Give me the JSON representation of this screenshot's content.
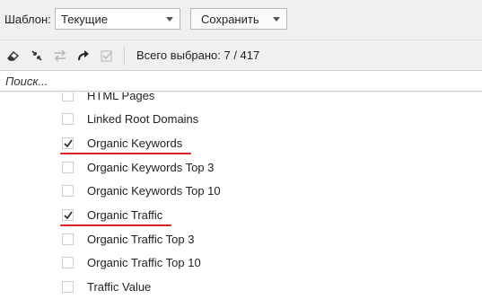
{
  "template": {
    "label": "Шаблон:",
    "selected": "Текущие",
    "save_label": "Сохранить"
  },
  "toolbar": {
    "icons": [
      "eraser-icon",
      "collapse-icon",
      "swap-icon",
      "redo-icon",
      "check-square-icon"
    ],
    "selection_count": "Всего выбрано: 7 / 417"
  },
  "search": {
    "placeholder": "Поиск..."
  },
  "columns": [
    {
      "label": "HTML Pages",
      "checked": false
    },
    {
      "label": "Linked Root Domains",
      "checked": false
    },
    {
      "label": "Organic Keywords",
      "checked": true
    },
    {
      "label": "Organic Keywords Top 3",
      "checked": false
    },
    {
      "label": "Organic Keywords Top 10",
      "checked": false
    },
    {
      "label": "Organic Traffic",
      "checked": true
    },
    {
      "label": "Organic Traffic Top 3",
      "checked": false
    },
    {
      "label": "Organic Traffic Top 10",
      "checked": false
    },
    {
      "label": "Traffic Value",
      "checked": false
    }
  ],
  "colors": {
    "highlight_underline": "#d91e1e",
    "checkmark": "#222222"
  }
}
